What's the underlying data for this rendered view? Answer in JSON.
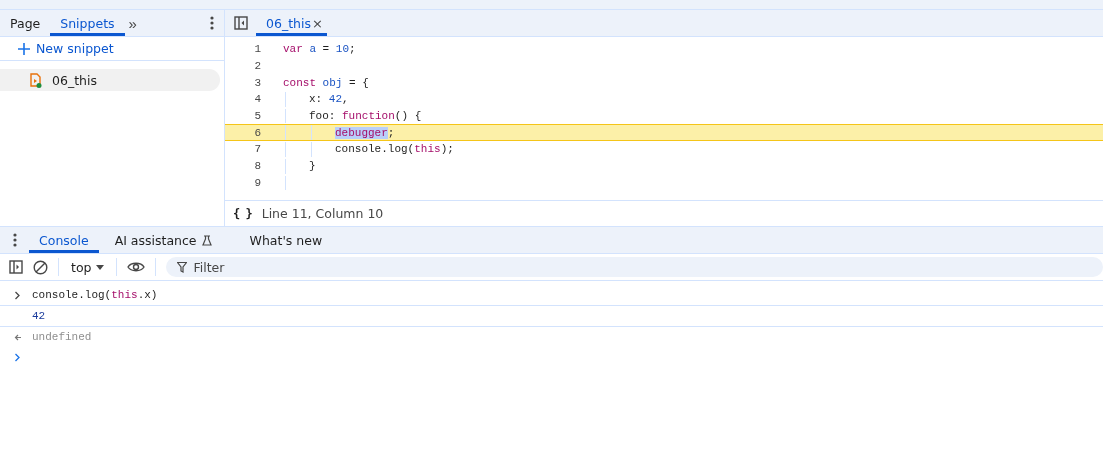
{
  "navigator": {
    "tabs": [
      {
        "label": "Page",
        "selected": false
      },
      {
        "label": "Snippets",
        "selected": true
      }
    ],
    "more": "»",
    "new_snippet": "New snippet",
    "snippets": [
      {
        "name": "06_this",
        "selected": true
      }
    ]
  },
  "editor": {
    "tabs": [
      {
        "label": "06_this",
        "selected": true,
        "close": "×"
      }
    ],
    "lines": [
      {
        "number": "1",
        "highlighted": false,
        "segments": [
          {
            "kind": "keyword",
            "text": "var"
          },
          {
            "kind": "name",
            "text": " a"
          },
          {
            "kind": "plain",
            "text": " = "
          },
          {
            "kind": "number",
            "text": "10"
          },
          {
            "kind": "plain",
            "text": ";"
          }
        ]
      },
      {
        "number": "2",
        "highlighted": false
      },
      {
        "number": "3",
        "highlighted": false,
        "segments": [
          {
            "kind": "keyword",
            "text": "const"
          },
          {
            "kind": "name",
            "text": " obj"
          },
          {
            "kind": "plain",
            "text": " = {"
          }
        ],
        "children": [
          {
            "number": "4",
            "highlighted": false,
            "segments": [
              {
                "kind": "plain",
                "text": "x: "
              },
              {
                "kind": "number",
                "text": "42"
              },
              {
                "kind": "plain",
                "text": ","
              }
            ]
          },
          {
            "number": "5",
            "highlighted": false,
            "segments": [
              {
                "kind": "plain",
                "text": "foo: "
              },
              {
                "kind": "keyword",
                "text": "function"
              },
              {
                "kind": "plain",
                "text": "() {"
              }
            ],
            "children": [
              {
                "number": "6",
                "highlighted": true,
                "segments": [
                  {
                    "kind": "keyword",
                    "text": "debugger",
                    "selected": true
                  },
                  {
                    "kind": "plain",
                    "text": ";"
                  }
                ]
              },
              {
                "number": "7",
                "highlighted": false,
                "segments": [
                  {
                    "kind": "plain",
                    "text": "console.log("
                  },
                  {
                    "kind": "keyword",
                    "text": "this"
                  },
                  {
                    "kind": "plain",
                    "text": ");"
                  }
                ]
              }
            ]
          },
          {
            "number": "8",
            "highlighted": false,
            "segments": [
              {
                "kind": "plain",
                "text": "}"
              }
            ]
          },
          {
            "number": "9",
            "highlighted": false
          }
        ]
      }
    ],
    "pretty_print": "{ }",
    "status": "Line 11, Column 10"
  },
  "drawer": {
    "tabs": [
      {
        "label": "Console",
        "selected": true
      },
      {
        "label": "AI assistance",
        "selected": false,
        "experimental": true
      },
      {
        "label": "What's new",
        "selected": false
      }
    ]
  },
  "toolbar": {
    "context": "top",
    "filter_placeholder": "Filter"
  },
  "console": [
    {
      "kind": "input",
      "segments": [
        {
          "kind": "plain",
          "text": "console.log("
        },
        {
          "kind": "keyword",
          "text": "this"
        },
        {
          "kind": "plain",
          "text": ".x)"
        }
      ]
    },
    {
      "kind": "output",
      "segments": [
        {
          "kind": "number",
          "text": "42"
        }
      ]
    },
    {
      "kind": "result",
      "segments": [
        {
          "kind": "plain",
          "text": "undefined"
        }
      ]
    }
  ]
}
